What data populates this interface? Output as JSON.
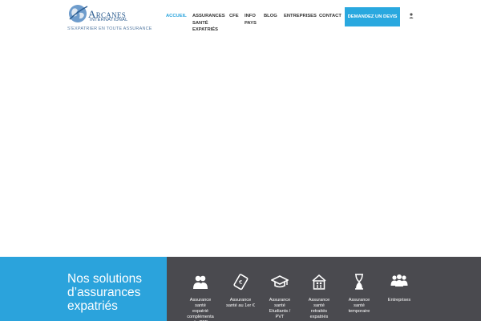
{
  "header": {
    "logo_name_initial": "A",
    "logo_name_rest": "RCANES",
    "logo_sub": "INTERNATIONAL",
    "tagline": "S'EXPATRIER EN TOUTE ASSURANCE"
  },
  "nav": {
    "items": [
      {
        "label": "ACCUEIL",
        "active": true
      },
      {
        "label": "ASSURANCES\nSANTÉ\nEXPATRIÉS"
      },
      {
        "label": "CFE"
      },
      {
        "label": "INFO\nPAYS"
      },
      {
        "label": "BLOG"
      },
      {
        "label": "ENTREPRISES"
      },
      {
        "label": "CONTACT"
      }
    ],
    "cta_label": "DEMANDEZ UN DEVIS",
    "account_icon": "user-icon"
  },
  "solutions": {
    "title": "Nos solutions d’assurances expatriés",
    "items": [
      {
        "icon": "people-icon",
        "label": "Assurance\nsanté\nexpatrié\ncomplémenta\nde CFE"
      },
      {
        "icon": "ticket-euro-icon",
        "label": "Assurance\nsanté au 1er €"
      },
      {
        "icon": "graduation-cap-icon",
        "label": "Assurance\nsanté\nEtudiants /\nPVT"
      },
      {
        "icon": "retirement-home-icon",
        "label": "Assurance\nsanté\nretraités\nexpatriés"
      },
      {
        "icon": "hourglass-icon",
        "label": "Assurance\nsanté\ntemporaire"
      },
      {
        "icon": "group-icon",
        "label": "Entreprises"
      }
    ]
  },
  "colors": {
    "accent": "#29a8df",
    "band_dark": "#4a4a4f",
    "nav_text": "#333333"
  }
}
